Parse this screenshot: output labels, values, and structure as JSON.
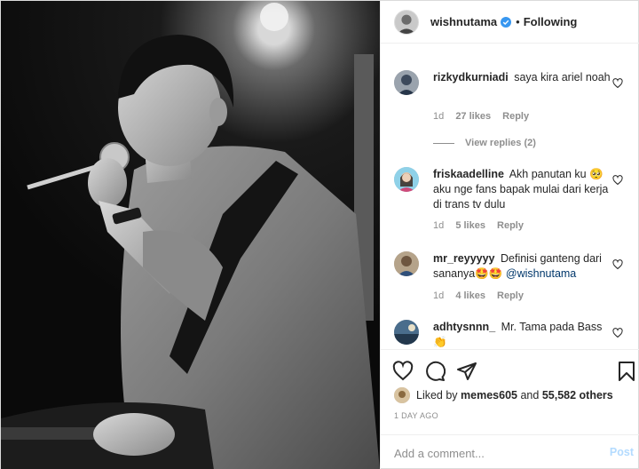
{
  "header": {
    "username": "wishnutama",
    "dot": "•",
    "following_label": "Following",
    "verified_icon": "verified-badge-icon",
    "verified_color": "#3897f0"
  },
  "comments": [
    {
      "username": "rizkydkurniadi",
      "text": "saya kira ariel noah",
      "age": "1d",
      "likes": "27 likes",
      "reply_label": "Reply",
      "view_replies": "View replies (2)"
    },
    {
      "username": "friskaadelline",
      "text": "Akh panutan ku 🥺 aku nge fans bapak mulai dari kerja di trans tv dulu",
      "age": "1d",
      "likes": "5 likes",
      "reply_label": "Reply"
    },
    {
      "username": "mr_reyyyyy",
      "text": "Definisi ganteng dari sananya🤩🤩",
      "mention": "@wishnutama",
      "age": "1d",
      "likes": "4 likes",
      "reply_label": "Reply"
    },
    {
      "username": "adhtysnnn_",
      "text": "Mr. Tama pada Bass 👏"
    }
  ],
  "actions": {
    "icons": [
      "heart-icon",
      "comment-icon",
      "share-icon",
      "bookmark-icon"
    ]
  },
  "likes": {
    "prefix": "Liked by",
    "user": "memes605",
    "and": "and",
    "others": "55,582 others"
  },
  "time_ago": "1 DAY AGO",
  "add_comment": {
    "placeholder": "Add a comment...",
    "post_label": "Post"
  }
}
